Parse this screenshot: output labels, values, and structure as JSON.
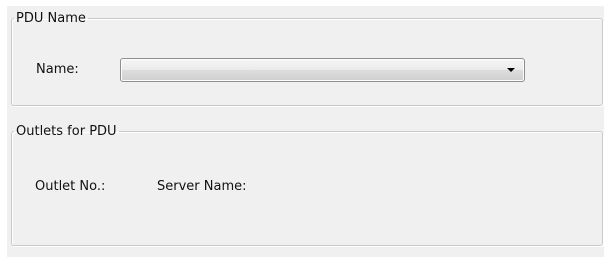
{
  "pdu_group": {
    "title": "PDU Name",
    "name_label": "Name:",
    "name_value": ""
  },
  "outlets_group": {
    "title": "Outlets for PDU",
    "outlet_no_label": "Outlet No.:",
    "server_name_label": "Server Name:"
  },
  "icons": {
    "dropdown": "chevron-down-icon"
  },
  "colors": {
    "panel_background": "#f0f0f0",
    "group_border": "#c9c9c9",
    "combo_border": "#8e8f8f"
  }
}
